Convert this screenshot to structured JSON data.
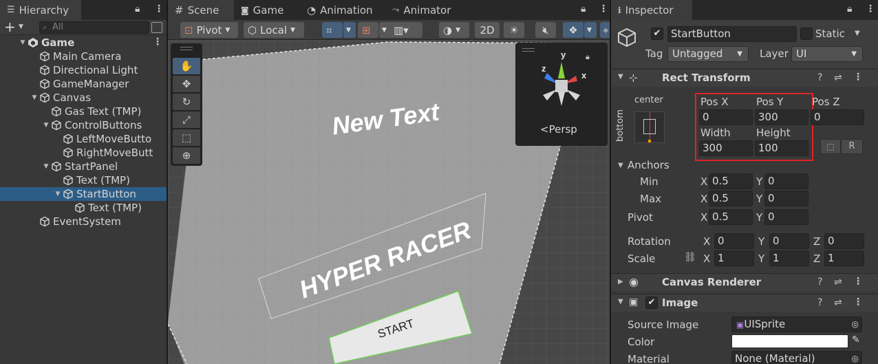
{
  "hierarchy": {
    "tab_label": "Hierarchy",
    "search_placeholder": "All",
    "add_label": "+",
    "rows": [
      {
        "label": "Game",
        "depth": 0,
        "arrow": "▼",
        "bold": true,
        "icon": "unity-logo-icon"
      },
      {
        "label": "Main Camera",
        "depth": 1,
        "arrow": "",
        "icon": "cube-icon"
      },
      {
        "label": "Directional Light",
        "depth": 1,
        "arrow": "",
        "icon": "cube-icon"
      },
      {
        "label": "GameManager",
        "depth": 1,
        "arrow": "",
        "icon": "cube-icon"
      },
      {
        "label": "Canvas",
        "depth": 1,
        "arrow": "▼",
        "icon": "cube-icon"
      },
      {
        "label": "Gas Text (TMP)",
        "depth": 2,
        "arrow": "",
        "icon": "cube-icon"
      },
      {
        "label": "ControlButtons",
        "depth": 2,
        "arrow": "▼",
        "icon": "cube-icon"
      },
      {
        "label": "LeftMoveButto",
        "depth": 3,
        "arrow": "",
        "icon": "cube-icon"
      },
      {
        "label": "RightMoveButt",
        "depth": 3,
        "arrow": "",
        "icon": "cube-icon"
      },
      {
        "label": "StartPanel",
        "depth": 2,
        "arrow": "▼",
        "icon": "cube-icon"
      },
      {
        "label": "Text (TMP)",
        "depth": 3,
        "arrow": "",
        "icon": "cube-icon"
      },
      {
        "label": "StartButton",
        "depth": 3,
        "arrow": "▼",
        "icon": "cube-icon",
        "selected": true
      },
      {
        "label": "Text (TMP)",
        "depth": 4,
        "arrow": "",
        "icon": "cube-icon"
      },
      {
        "label": "EventSystem",
        "depth": 1,
        "arrow": "",
        "icon": "cube-icon"
      }
    ]
  },
  "scene": {
    "tabs": [
      {
        "label": "Scene",
        "icon": "grid-icon",
        "active": true
      },
      {
        "label": "Game",
        "icon": "gamepad-icon"
      },
      {
        "label": "Animation",
        "icon": "clock-icon"
      },
      {
        "label": "Animator",
        "icon": "animator-icon"
      }
    ],
    "toolbar": {
      "pivot_label": "Pivot",
      "local_label": "Local",
      "twod_label": "2D"
    },
    "viewport": {
      "new_text": "New Text",
      "title_text": "HYPER RACER",
      "start_text": "START",
      "persp_label": "Persp",
      "axis_x": "x",
      "axis_y": "y",
      "axis_z": "z"
    }
  },
  "inspector": {
    "tab_label": "Inspector",
    "object_name": "StartButton",
    "active_checked": true,
    "static_label": "Static",
    "tag_label": "Tag",
    "tag_value": "Untagged",
    "layer_label": "Layer",
    "layer_value": "UI",
    "rect_transform": {
      "title": "Rect Transform",
      "anchor_h": "center",
      "anchor_v": "bottom",
      "pos_x_label": "Pos X",
      "pos_y_label": "Pos Y",
      "pos_z_label": "Pos Z",
      "pos_x": "0",
      "pos_y": "300",
      "pos_z": "0",
      "width_label": "Width",
      "height_label": "Height",
      "width": "300",
      "height": "100",
      "raw_edit_label": "R",
      "anchors_label": "Anchors",
      "min_label": "Min",
      "max_label": "Max",
      "pivot_label": "Pivot",
      "min_x": "0.5",
      "min_y": "0",
      "max_x": "0.5",
      "max_y": "0",
      "pivot_x": "0.5",
      "pivot_y": "0",
      "rotation_label": "Rotation",
      "scale_label": "Scale",
      "rot_x": "0",
      "rot_y": "0",
      "rot_z": "0",
      "scale_x": "1",
      "scale_y": "1",
      "scale_z": "1",
      "x_label": "X",
      "y_label": "Y",
      "z_label": "Z"
    },
    "canvas_renderer": {
      "title": "Canvas Renderer"
    },
    "image": {
      "title": "Image",
      "enabled": true,
      "source_image_label": "Source Image",
      "source_image_value": "UISprite",
      "color_label": "Color",
      "color_value": "#ffffff",
      "material_label": "Material",
      "material_value": "None (Material)"
    },
    "highlight_color": "#e02424"
  },
  "colors": {
    "selection": "#2c5d87",
    "active_tool": "#46607c"
  }
}
